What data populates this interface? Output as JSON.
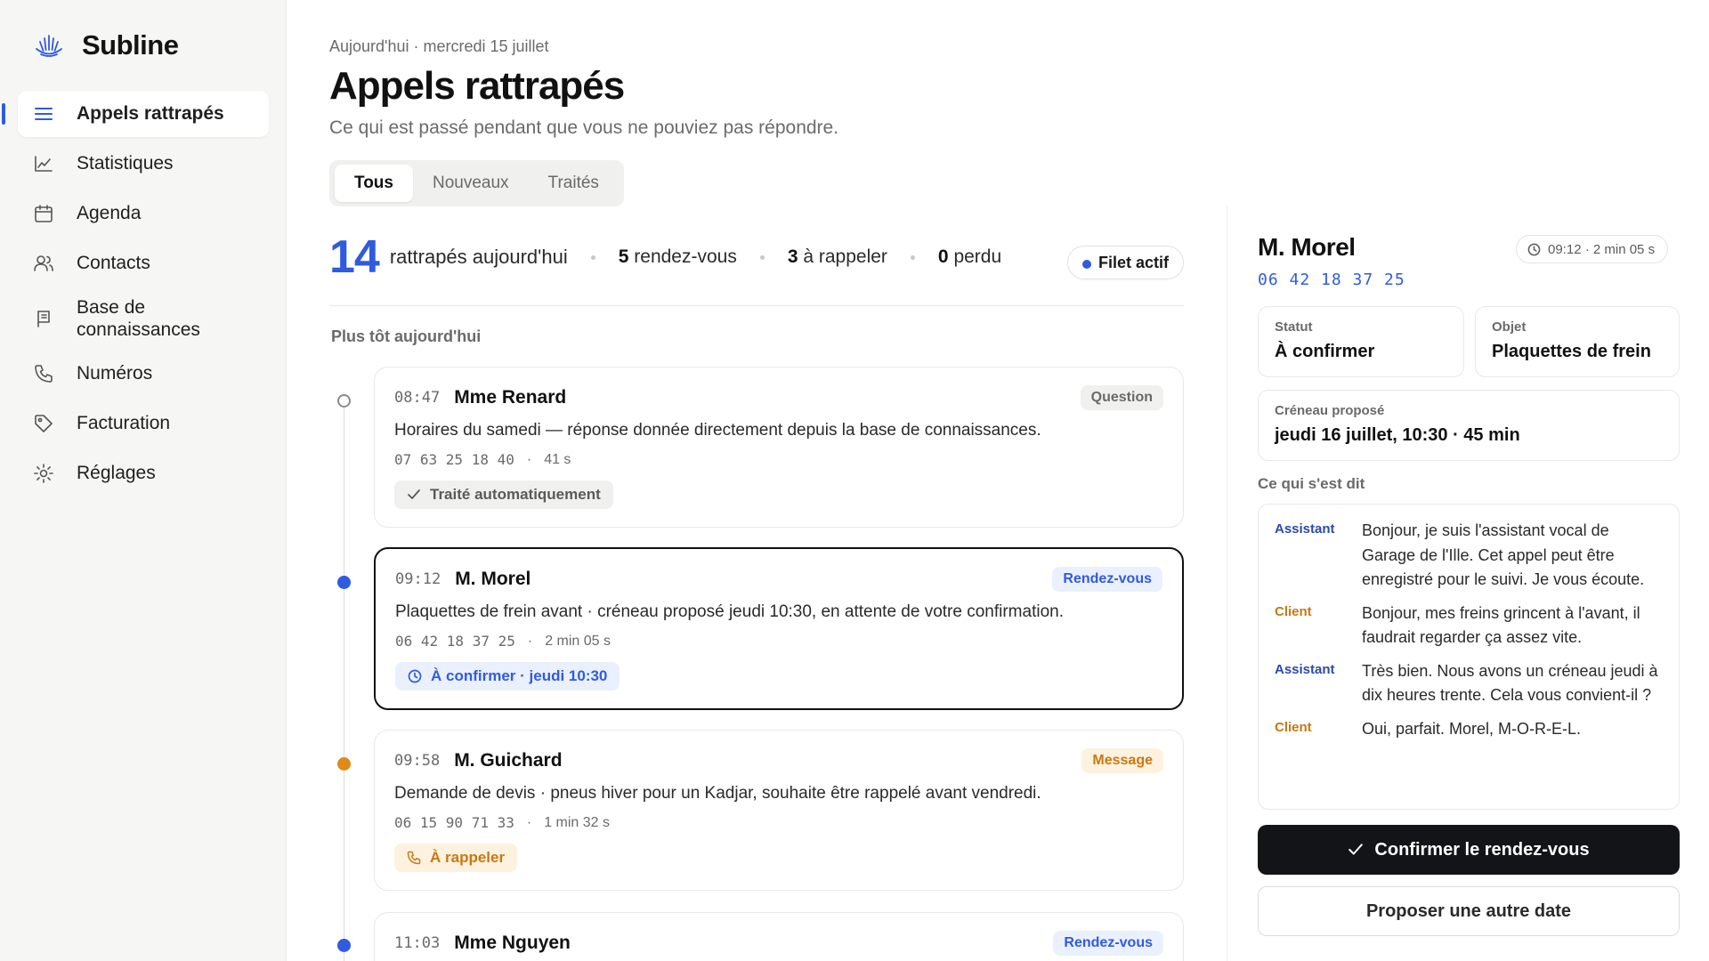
{
  "app": {
    "name": "Subline",
    "logo_icon": "lotus-logo-icon"
  },
  "sidebar": {
    "items": [
      {
        "label": "Appels rattrapés",
        "icon": "list-icon",
        "active": true
      },
      {
        "label": "Statistiques",
        "icon": "chart-line-icon"
      },
      {
        "label": "Agenda",
        "icon": "calendar-icon"
      },
      {
        "label": "Contacts",
        "icon": "users-icon"
      },
      {
        "label": "Base de connaissances",
        "icon": "book-icon"
      },
      {
        "label": "Numéros",
        "icon": "phone-icon"
      },
      {
        "label": "Facturation",
        "icon": "tag-icon"
      },
      {
        "label": "Réglages",
        "icon": "settings-icon"
      }
    ]
  },
  "header": {
    "date": "Aujourd'hui · mercredi 15 juillet",
    "title": "Appels rattrapés",
    "subtitle": "Ce qui est passé pendant que vous ne pouviez pas répondre."
  },
  "tabs": [
    {
      "label": "Tous",
      "active": true
    },
    {
      "label": "Nouveaux"
    },
    {
      "label": "Traités"
    }
  ],
  "stats": {
    "count": "14",
    "count_label": "rattrapés aujourd'hui",
    "rdv_value": "5",
    "rdv_label": "rendez-vous",
    "rappel_value": "3",
    "rappel_label": "à rappeler",
    "perdu_value": "0",
    "perdu_label": "perdu",
    "filet_label": "Filet actif"
  },
  "section_label": "Plus tôt aujourd'hui",
  "calls": [
    {
      "time": "08:47",
      "name": "Mme Renard",
      "tag": "Question",
      "desc": "Horaires du samedi — réponse donnée directement depuis la base de connaissances.",
      "phone": "07 63 25 18 40",
      "duration": "41 s",
      "status": "Traité automatiquement"
    },
    {
      "time": "09:12",
      "name": "M. Morel",
      "tag": "Rendez-vous",
      "desc": "Plaquettes de frein avant · créneau proposé jeudi 10:30, en attente de votre confirmation.",
      "phone": "06 42 18 37 25",
      "duration": "2 min 05 s",
      "status": "À confirmer · jeudi 10:30"
    },
    {
      "time": "09:58",
      "name": "M. Guichard",
      "tag": "Message",
      "desc": "Demande de devis · pneus hiver pour un Kadjar, souhaite être rappelé avant vendredi.",
      "phone": "06 15 90 71 33",
      "duration": "1 min 32 s",
      "status": "À rappeler"
    },
    {
      "time": "11:03",
      "name": "Mme Nguyen",
      "tag": "Rendez-vous"
    }
  ],
  "detail": {
    "name": "M. Morel",
    "phone": "06 42 18 37 25",
    "time": "09:12 · 2 min 05 s",
    "statut_label": "Statut",
    "statut_value": "À confirmer",
    "objet_label": "Objet",
    "objet_value": "Plaquettes de frein",
    "creneau_label": "Créneau proposé",
    "creneau_value": "jeudi 16 juillet, 10:30 · 45 min",
    "transcript_title": "Ce qui s'est dit",
    "transcript": [
      {
        "who": "Assistant",
        "text": "Bonjour, je suis l'assistant vocal de Garage de l'Ille. Cet appel peut être enregistré pour le suivi. Je vous écoute."
      },
      {
        "who": "Client",
        "text": "Bonjour, mes freins grincent à l'avant, il faudrait regarder ça assez vite."
      },
      {
        "who": "Assistant",
        "text": "Très bien. Nous avons un créneau jeudi à dix heures trente. Cela vous convient-il ?"
      },
      {
        "who": "Client",
        "text": "Oui, parfait. Morel, M-O-R-E-L."
      }
    ],
    "confirm_label": "Confirmer le rendez-vous",
    "other_label": "Proposer une autre date"
  },
  "colors": {
    "accent": "#2f5be0",
    "orange": "#e08a1c",
    "dark_button": "#121417"
  }
}
